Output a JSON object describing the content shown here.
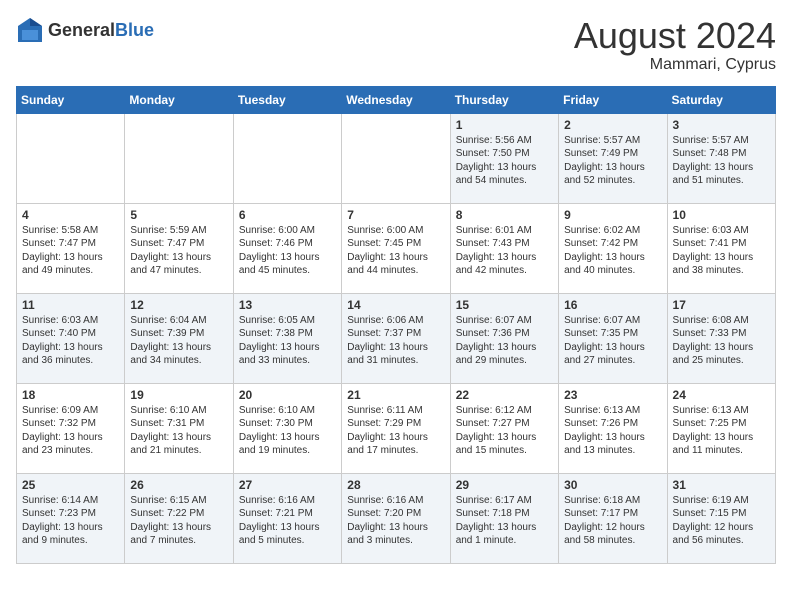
{
  "header": {
    "logo_general": "General",
    "logo_blue": "Blue",
    "month_year": "August 2024",
    "location": "Mammari, Cyprus"
  },
  "weekdays": [
    "Sunday",
    "Monday",
    "Tuesday",
    "Wednesday",
    "Thursday",
    "Friday",
    "Saturday"
  ],
  "weeks": [
    [
      {
        "day": "",
        "sunrise": "",
        "sunset": "",
        "daylight": ""
      },
      {
        "day": "",
        "sunrise": "",
        "sunset": "",
        "daylight": ""
      },
      {
        "day": "",
        "sunrise": "",
        "sunset": "",
        "daylight": ""
      },
      {
        "day": "",
        "sunrise": "",
        "sunset": "",
        "daylight": ""
      },
      {
        "day": "1",
        "sunrise": "Sunrise: 5:56 AM",
        "sunset": "Sunset: 7:50 PM",
        "daylight": "Daylight: 13 hours and 54 minutes."
      },
      {
        "day": "2",
        "sunrise": "Sunrise: 5:57 AM",
        "sunset": "Sunset: 7:49 PM",
        "daylight": "Daylight: 13 hours and 52 minutes."
      },
      {
        "day": "3",
        "sunrise": "Sunrise: 5:57 AM",
        "sunset": "Sunset: 7:48 PM",
        "daylight": "Daylight: 13 hours and 51 minutes."
      }
    ],
    [
      {
        "day": "4",
        "sunrise": "Sunrise: 5:58 AM",
        "sunset": "Sunset: 7:47 PM",
        "daylight": "Daylight: 13 hours and 49 minutes."
      },
      {
        "day": "5",
        "sunrise": "Sunrise: 5:59 AM",
        "sunset": "Sunset: 7:47 PM",
        "daylight": "Daylight: 13 hours and 47 minutes."
      },
      {
        "day": "6",
        "sunrise": "Sunrise: 6:00 AM",
        "sunset": "Sunset: 7:46 PM",
        "daylight": "Daylight: 13 hours and 45 minutes."
      },
      {
        "day": "7",
        "sunrise": "Sunrise: 6:00 AM",
        "sunset": "Sunset: 7:45 PM",
        "daylight": "Daylight: 13 hours and 44 minutes."
      },
      {
        "day": "8",
        "sunrise": "Sunrise: 6:01 AM",
        "sunset": "Sunset: 7:43 PM",
        "daylight": "Daylight: 13 hours and 42 minutes."
      },
      {
        "day": "9",
        "sunrise": "Sunrise: 6:02 AM",
        "sunset": "Sunset: 7:42 PM",
        "daylight": "Daylight: 13 hours and 40 minutes."
      },
      {
        "day": "10",
        "sunrise": "Sunrise: 6:03 AM",
        "sunset": "Sunset: 7:41 PM",
        "daylight": "Daylight: 13 hours and 38 minutes."
      }
    ],
    [
      {
        "day": "11",
        "sunrise": "Sunrise: 6:03 AM",
        "sunset": "Sunset: 7:40 PM",
        "daylight": "Daylight: 13 hours and 36 minutes."
      },
      {
        "day": "12",
        "sunrise": "Sunrise: 6:04 AM",
        "sunset": "Sunset: 7:39 PM",
        "daylight": "Daylight: 13 hours and 34 minutes."
      },
      {
        "day": "13",
        "sunrise": "Sunrise: 6:05 AM",
        "sunset": "Sunset: 7:38 PM",
        "daylight": "Daylight: 13 hours and 33 minutes."
      },
      {
        "day": "14",
        "sunrise": "Sunrise: 6:06 AM",
        "sunset": "Sunset: 7:37 PM",
        "daylight": "Daylight: 13 hours and 31 minutes."
      },
      {
        "day": "15",
        "sunrise": "Sunrise: 6:07 AM",
        "sunset": "Sunset: 7:36 PM",
        "daylight": "Daylight: 13 hours and 29 minutes."
      },
      {
        "day": "16",
        "sunrise": "Sunrise: 6:07 AM",
        "sunset": "Sunset: 7:35 PM",
        "daylight": "Daylight: 13 hours and 27 minutes."
      },
      {
        "day": "17",
        "sunrise": "Sunrise: 6:08 AM",
        "sunset": "Sunset: 7:33 PM",
        "daylight": "Daylight: 13 hours and 25 minutes."
      }
    ],
    [
      {
        "day": "18",
        "sunrise": "Sunrise: 6:09 AM",
        "sunset": "Sunset: 7:32 PM",
        "daylight": "Daylight: 13 hours and 23 minutes."
      },
      {
        "day": "19",
        "sunrise": "Sunrise: 6:10 AM",
        "sunset": "Sunset: 7:31 PM",
        "daylight": "Daylight: 13 hours and 21 minutes."
      },
      {
        "day": "20",
        "sunrise": "Sunrise: 6:10 AM",
        "sunset": "Sunset: 7:30 PM",
        "daylight": "Daylight: 13 hours and 19 minutes."
      },
      {
        "day": "21",
        "sunrise": "Sunrise: 6:11 AM",
        "sunset": "Sunset: 7:29 PM",
        "daylight": "Daylight: 13 hours and 17 minutes."
      },
      {
        "day": "22",
        "sunrise": "Sunrise: 6:12 AM",
        "sunset": "Sunset: 7:27 PM",
        "daylight": "Daylight: 13 hours and 15 minutes."
      },
      {
        "day": "23",
        "sunrise": "Sunrise: 6:13 AM",
        "sunset": "Sunset: 7:26 PM",
        "daylight": "Daylight: 13 hours and 13 minutes."
      },
      {
        "day": "24",
        "sunrise": "Sunrise: 6:13 AM",
        "sunset": "Sunset: 7:25 PM",
        "daylight": "Daylight: 13 hours and 11 minutes."
      }
    ],
    [
      {
        "day": "25",
        "sunrise": "Sunrise: 6:14 AM",
        "sunset": "Sunset: 7:23 PM",
        "daylight": "Daylight: 13 hours and 9 minutes."
      },
      {
        "day": "26",
        "sunrise": "Sunrise: 6:15 AM",
        "sunset": "Sunset: 7:22 PM",
        "daylight": "Daylight: 13 hours and 7 minutes."
      },
      {
        "day": "27",
        "sunrise": "Sunrise: 6:16 AM",
        "sunset": "Sunset: 7:21 PM",
        "daylight": "Daylight: 13 hours and 5 minutes."
      },
      {
        "day": "28",
        "sunrise": "Sunrise: 6:16 AM",
        "sunset": "Sunset: 7:20 PM",
        "daylight": "Daylight: 13 hours and 3 minutes."
      },
      {
        "day": "29",
        "sunrise": "Sunrise: 6:17 AM",
        "sunset": "Sunset: 7:18 PM",
        "daylight": "Daylight: 13 hours and 1 minute."
      },
      {
        "day": "30",
        "sunrise": "Sunrise: 6:18 AM",
        "sunset": "Sunset: 7:17 PM",
        "daylight": "Daylight: 12 hours and 58 minutes."
      },
      {
        "day": "31",
        "sunrise": "Sunrise: 6:19 AM",
        "sunset": "Sunset: 7:15 PM",
        "daylight": "Daylight: 12 hours and 56 minutes."
      }
    ]
  ]
}
